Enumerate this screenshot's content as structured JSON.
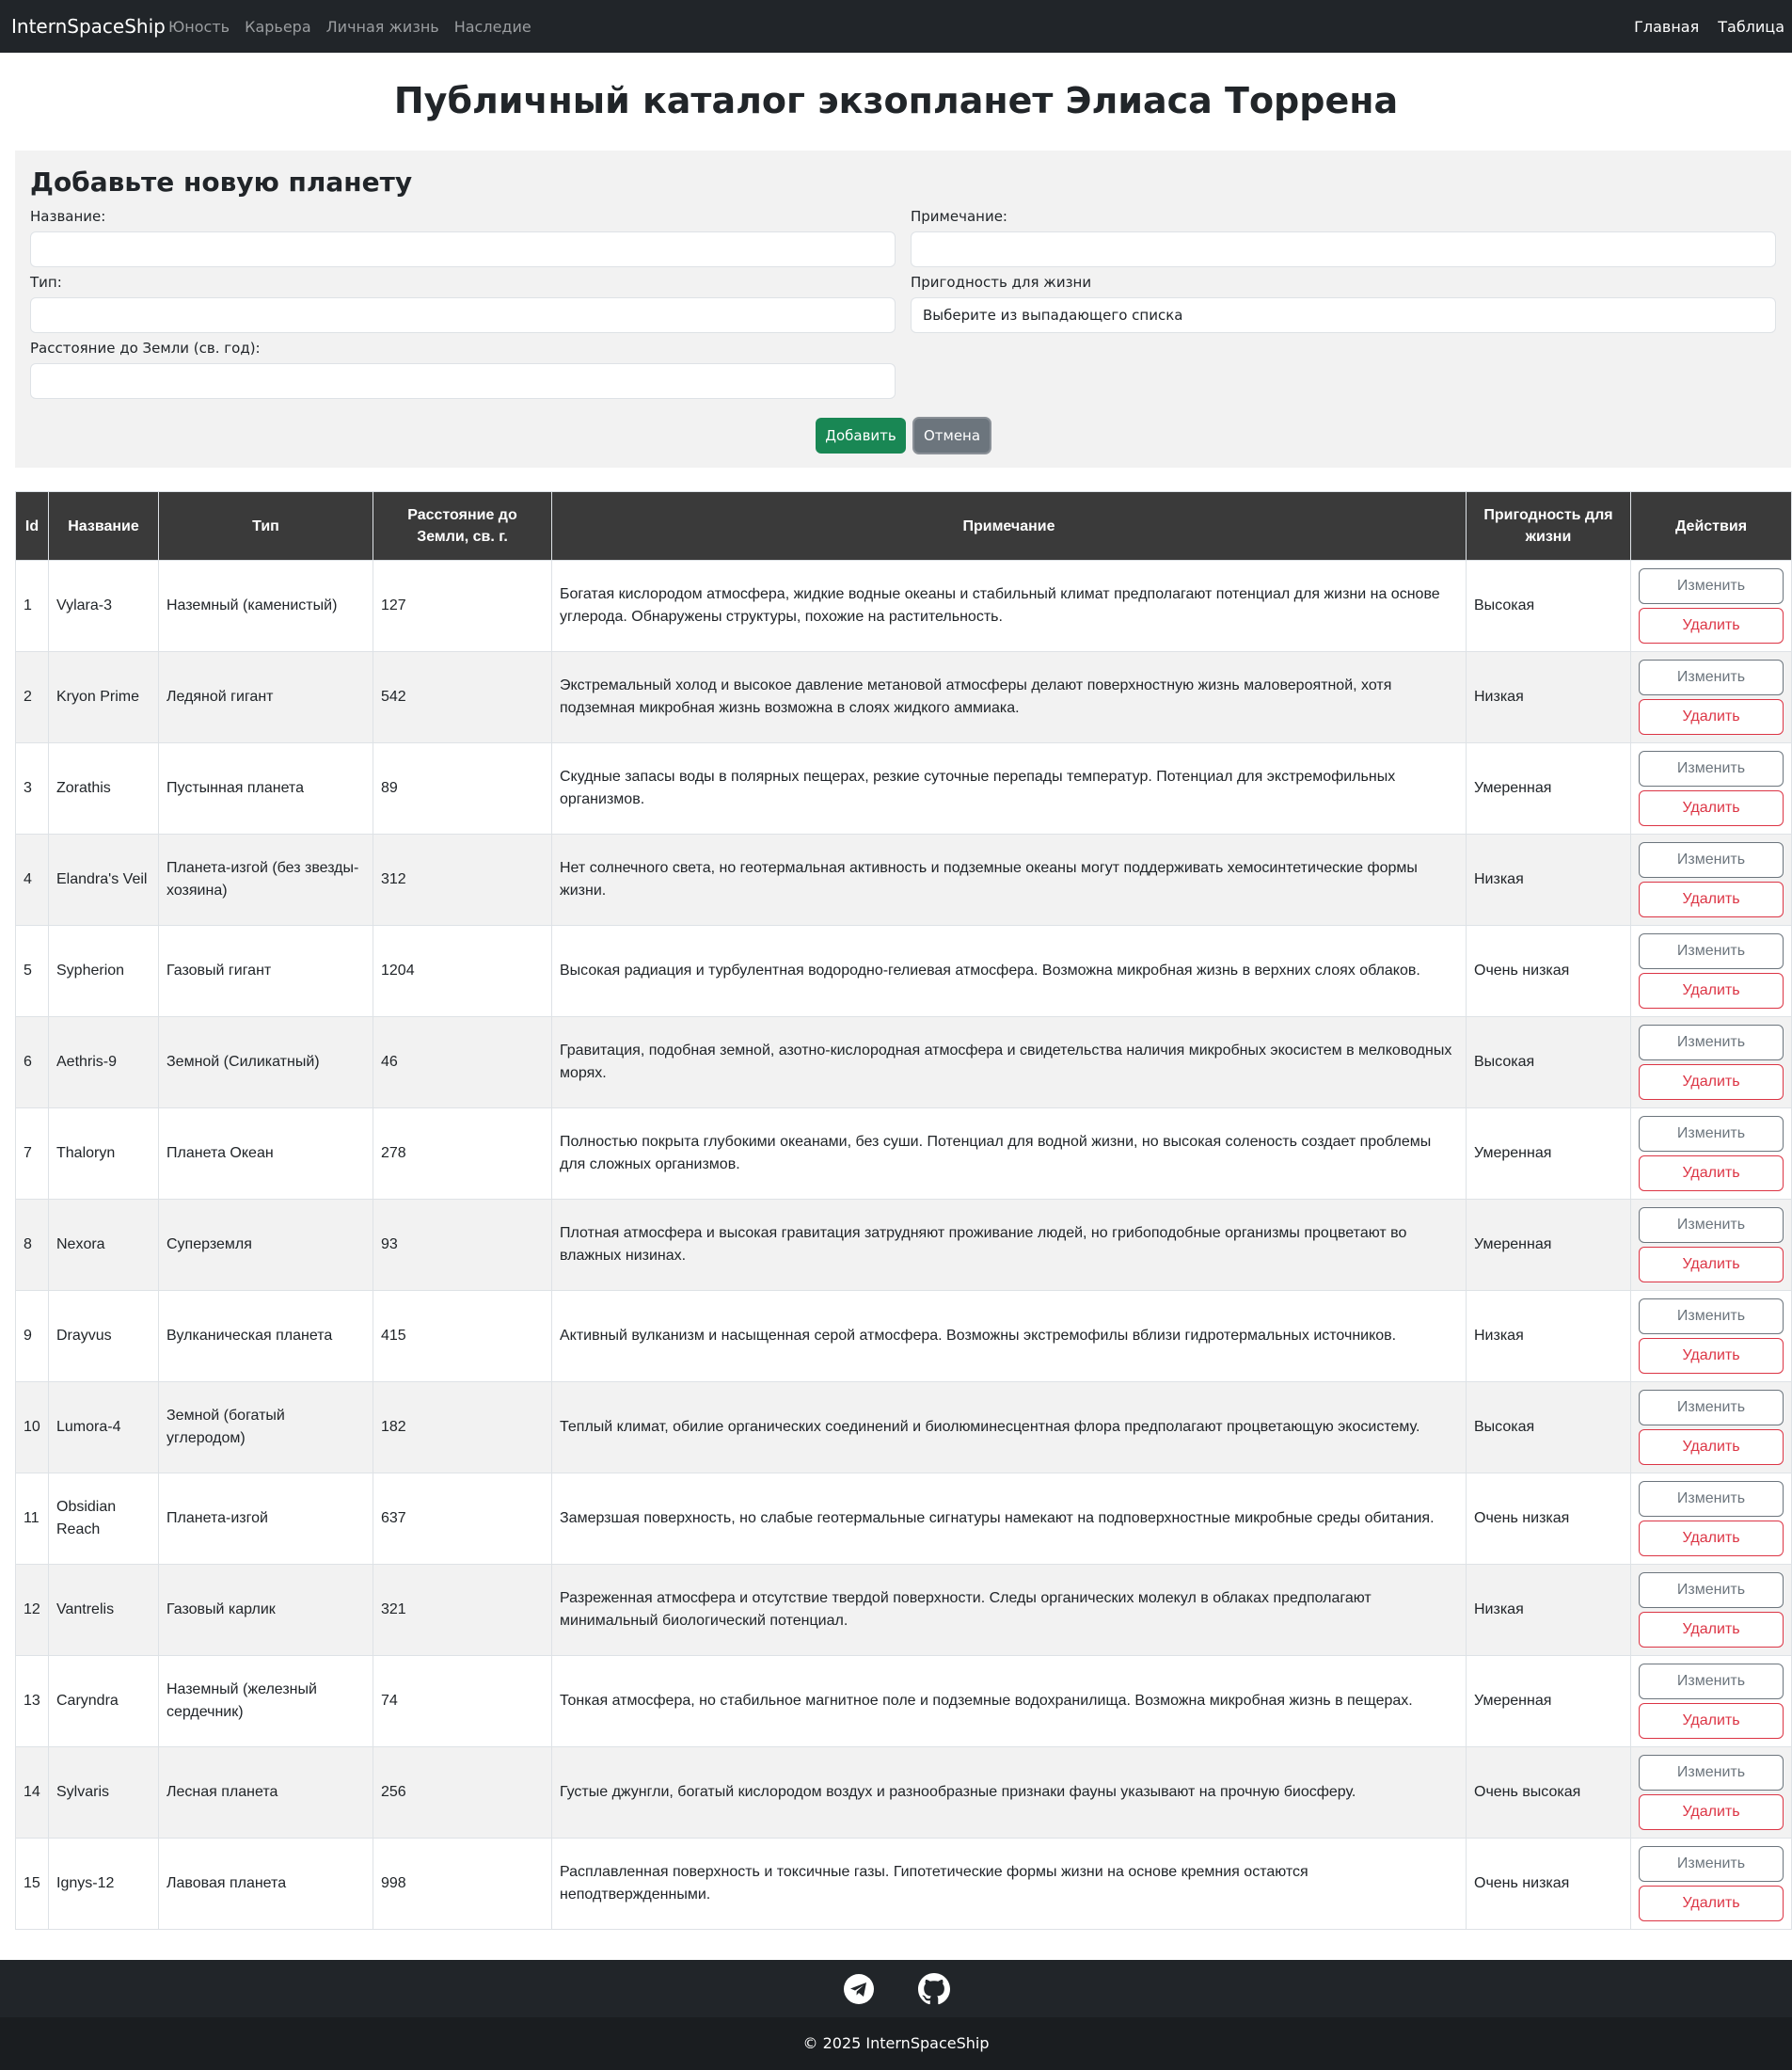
{
  "navbar": {
    "brand": "InternSpaceShip",
    "links": [
      "Юность",
      "Карьера",
      "Личная жизнь",
      "Наследие"
    ],
    "right_links": [
      "Главная",
      "Таблица"
    ]
  },
  "page_title": "Публичный каталог экзопланет Элиаса Торрена",
  "form": {
    "title": "Добавьте новую планету",
    "name_label": "Название:",
    "type_label": "Тип:",
    "distance_label": "Расстояние до Земли (св. год):",
    "note_label": "Примечание:",
    "habitability_label": "Пригодность для жизни",
    "habitability_value": "Выберите из выпадающего списка",
    "add_button": "Добавить",
    "cancel_button": "Отмена"
  },
  "table": {
    "headers": [
      "Id",
      "Название",
      "Тип",
      "Расстояние до Земли, св. г.",
      "Примечание",
      "Пригодность для жизни",
      "Действия"
    ],
    "edit_label": "Изменить",
    "delete_label": "Удалить",
    "rows": [
      {
        "id": "1",
        "name": "Vylara-3",
        "type": "Наземный (каменистый)",
        "distance": "127",
        "note": "Богатая кислородом атмосфера, жидкие водные океаны и стабильный климат предполагают потенциал для жизни на основе углерода. Обнаружены структуры, похожие на растительность.",
        "habitability": "Высокая"
      },
      {
        "id": "2",
        "name": "Kryon Prime",
        "type": "Ледяной гигант",
        "distance": "542",
        "note": "Экстремальный холод и высокое давление метановой атмосферы делают поверхностную жизнь маловероятной, хотя подземная микробная жизнь возможна в слоях жидкого аммиака.",
        "habitability": "Низкая"
      },
      {
        "id": "3",
        "name": "Zorathis",
        "type": "Пустынная планета",
        "distance": "89",
        "note": "Скудные запасы воды в полярных пещерах, резкие суточные перепады температур. Потенциал для экстремофильных организмов.",
        "habitability": "Умеренная"
      },
      {
        "id": "4",
        "name": "Elandra's Veil",
        "type": "Планета-изгой (без звезды-хозяина)",
        "distance": "312",
        "note": "Нет солнечного света, но геотермальная активность и подземные океаны могут поддерживать хемосинтетические формы жизни.",
        "habitability": "Низкая"
      },
      {
        "id": "5",
        "name": "Sypherion",
        "type": "Газовый гигант",
        "distance": "1204",
        "note": "Высокая радиация и турбулентная водородно-гелиевая атмосфера. Возможна микробная жизнь в верхних слоях облаков.",
        "habitability": "Очень низкая"
      },
      {
        "id": "6",
        "name": "Aethris-9",
        "type": "Земной (Силикатный)",
        "distance": "46",
        "note": "Гравитация, подобная земной, азотно-кислородная атмосфера и свидетельства наличия микробных экосистем в мелководных морях.",
        "habitability": "Высокая"
      },
      {
        "id": "7",
        "name": "Thaloryn",
        "type": "Планета Океан",
        "distance": "278",
        "note": "Полностью покрыта глубокими океанами, без суши. Потенциал для водной жизни, но высокая соленость создает проблемы для сложных организмов.",
        "habitability": "Умеренная"
      },
      {
        "id": "8",
        "name": "Nexora",
        "type": "Суперземля",
        "distance": "93",
        "note": "Плотная атмосфера и высокая гравитация затрудняют проживание людей, но грибоподобные организмы процветают во влажных низинах.",
        "habitability": "Умеренная"
      },
      {
        "id": "9",
        "name": "Drayvus",
        "type": "Вулканическая планета",
        "distance": "415",
        "note": "Активный вулканизм и насыщенная серой атмосфера. Возможны экстремофилы вблизи гидротермальных источников.",
        "habitability": "Низкая"
      },
      {
        "id": "10",
        "name": "Lumora-4",
        "type": "Земной (богатый углеродом)",
        "distance": "182",
        "note": "Теплый климат, обилие органических соединений и биолюминесцентная флора предполагают процветающую экосистему.",
        "habitability": "Высокая"
      },
      {
        "id": "11",
        "name": "Obsidian Reach",
        "type": "Планета-изгой",
        "distance": "637",
        "note": "Замерзшая поверхность, но слабые геотермальные сигнатуры намекают на подповерхностные микробные среды обитания.",
        "habitability": "Очень низкая"
      },
      {
        "id": "12",
        "name": "Vantrelis",
        "type": "Газовый карлик",
        "distance": "321",
        "note": "Разреженная атмосфера и отсутствие твердой поверхности. Следы органических молекул в облаках предполагают минимальный биологический потенциал.",
        "habitability": "Низкая"
      },
      {
        "id": "13",
        "name": "Caryndra",
        "type": "Наземный (железный сердечник)",
        "distance": "74",
        "note": "Тонкая атмосфера, но стабильное магнитное поле и подземные водохранилища. Возможна микробная жизнь в пещерах.",
        "habitability": "Умеренная"
      },
      {
        "id": "14",
        "name": "Sylvaris",
        "type": "Лесная планета",
        "distance": "256",
        "note": "Густые джунгли, богатый кислородом воздух и разнообразные признаки фауны указывают на прочную биосферу.",
        "habitability": "Очень высокая"
      },
      {
        "id": "15",
        "name": "Ignys-12",
        "type": "Лавовая планета",
        "distance": "998",
        "note": "Расплавленная поверхность и токсичные газы. Гипотетические формы жизни на основе кремния остаются неподтвержденными.",
        "habitability": "Очень низкая"
      }
    ]
  },
  "footer": {
    "icons": [
      "telegram-icon",
      "github-icon"
    ],
    "copyright": "© 2025 InternSpaceShip"
  },
  "colors": {
    "navbar_bg": "#212529",
    "success": "#198754",
    "secondary": "#6c757d",
    "danger": "#dc3545",
    "table_header_bg": "#3a3a3a"
  }
}
